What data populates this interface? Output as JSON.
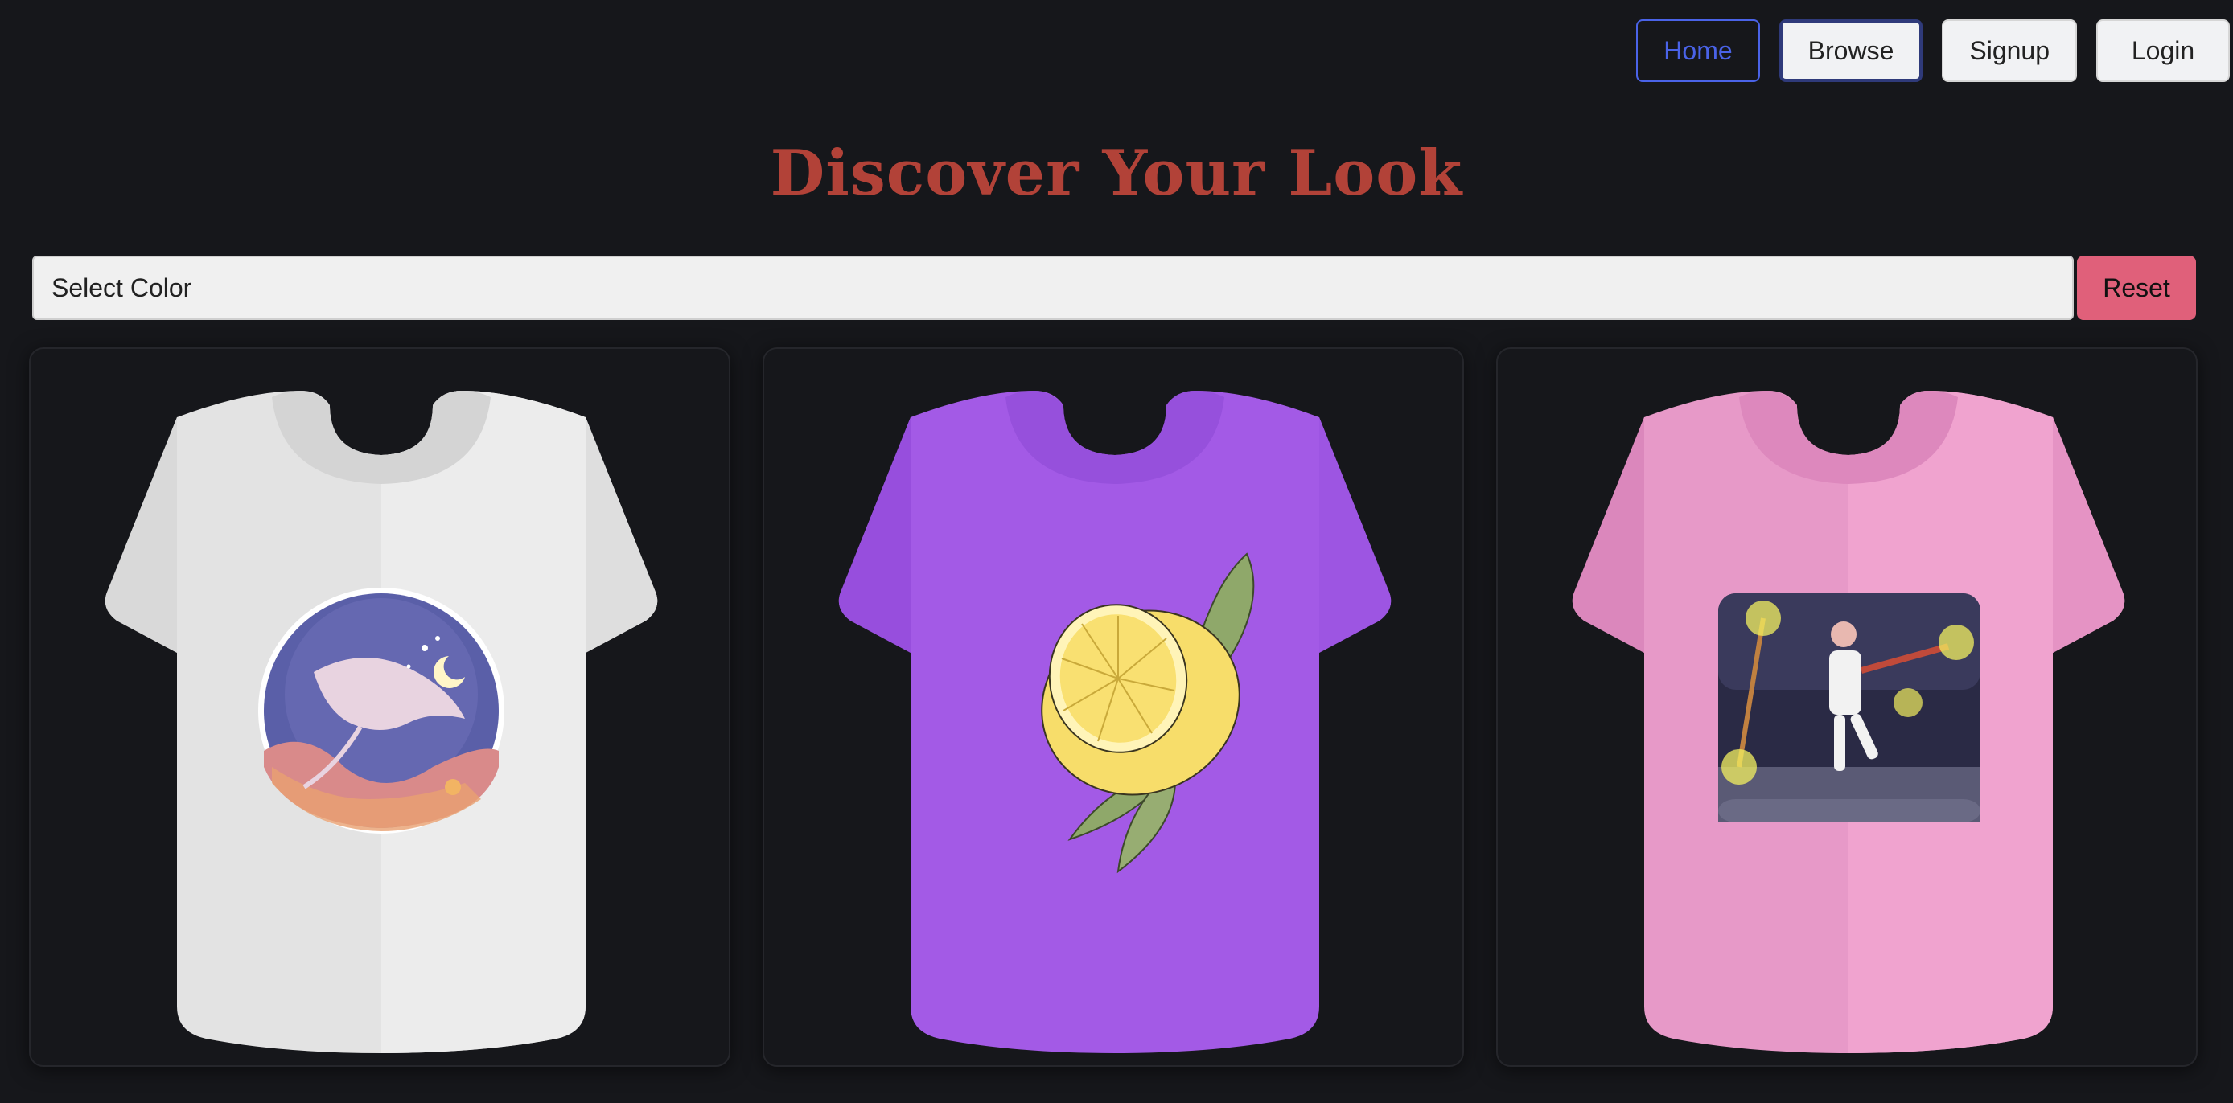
{
  "nav": {
    "home": "Home",
    "browse": "Browse",
    "signup": "Signup",
    "login": "Login"
  },
  "page_title": "Discover Your Look",
  "filter": {
    "select_color": "Select Color",
    "reset": "Reset"
  },
  "colors": {
    "background": "#16171b",
    "title": "#b24238",
    "home_accent": "#4a63e8",
    "reset": "#e0607a"
  },
  "products": [
    {
      "shirt_color": "#e8e8e8",
      "design": "manta-ray-ocean-circle-print"
    },
    {
      "shirt_color": "#a35ae6",
      "design": "lemon-with-leaves-print"
    },
    {
      "shirt_color": "#eb9dcb",
      "design": "robot-dancer-cartoon-print"
    }
  ]
}
